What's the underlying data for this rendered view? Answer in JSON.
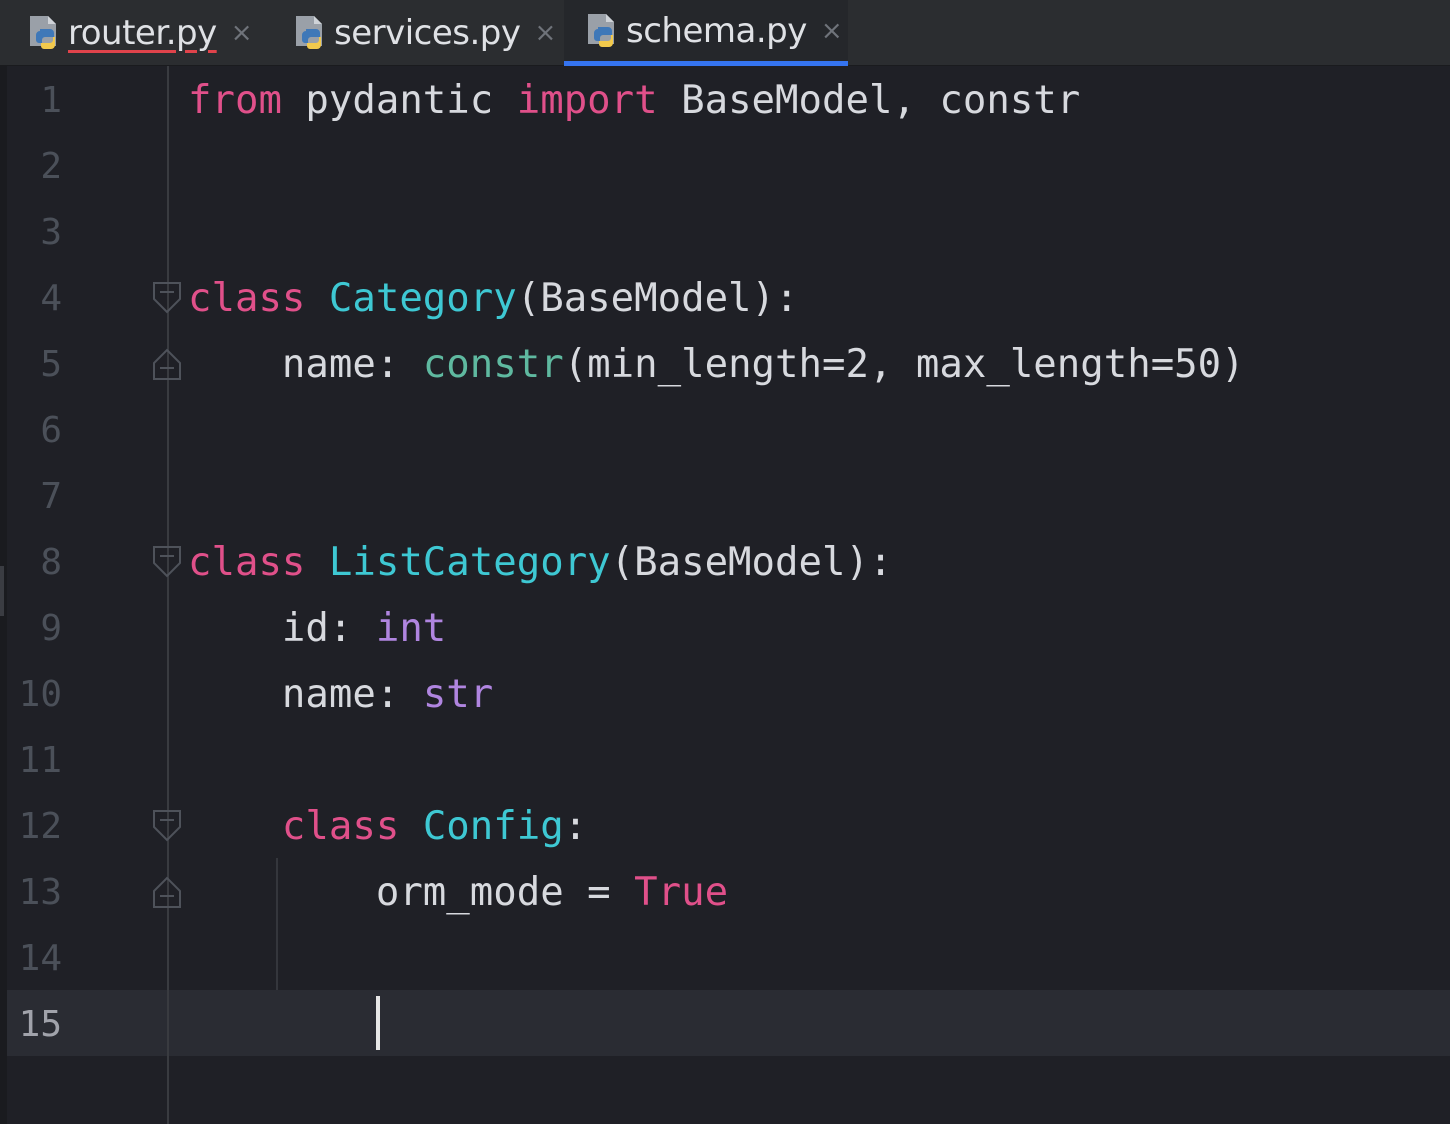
{
  "tabs": [
    {
      "label": "router.py",
      "close": "×",
      "icon": "python-file-icon",
      "has_error": true
    },
    {
      "label": "services.py",
      "close": "×",
      "icon": "python-file-icon"
    },
    {
      "label": "schema.py",
      "close": "×",
      "icon": "python-file-icon",
      "active": true
    }
  ],
  "editor": {
    "current_line": 15,
    "lines": [
      {
        "n": "1",
        "t": [
          [
            "kw",
            "from"
          ],
          [
            "tx",
            " pydantic "
          ],
          [
            "kw",
            "import"
          ],
          [
            "tx",
            " BaseModel, constr"
          ]
        ]
      },
      {
        "n": "2",
        "t": []
      },
      {
        "n": "3",
        "t": []
      },
      {
        "n": "4",
        "t": [
          [
            "kw",
            "class"
          ],
          [
            "tx",
            " "
          ],
          [
            "cls",
            "Category"
          ],
          [
            "tx",
            "(BaseModel):"
          ]
        ]
      },
      {
        "n": "5",
        "t": [
          [
            "tx",
            "    name: "
          ],
          [
            "fn",
            "constr"
          ],
          [
            "tx",
            "(min_length=2, max_length=50)"
          ]
        ]
      },
      {
        "n": "6",
        "t": []
      },
      {
        "n": "7",
        "t": []
      },
      {
        "n": "8",
        "t": [
          [
            "kw",
            "class"
          ],
          [
            "tx",
            " "
          ],
          [
            "cls",
            "ListCategory"
          ],
          [
            "tx",
            "(BaseModel):"
          ]
        ]
      },
      {
        "n": "9",
        "t": [
          [
            "tx",
            "    id: "
          ],
          [
            "bi",
            "int"
          ]
        ]
      },
      {
        "n": "10",
        "t": [
          [
            "tx",
            "    name: "
          ],
          [
            "bi",
            "str"
          ]
        ]
      },
      {
        "n": "11",
        "t": []
      },
      {
        "n": "12",
        "t": [
          [
            "tx",
            "    "
          ],
          [
            "kw",
            "class"
          ],
          [
            "tx",
            " "
          ],
          [
            "cls",
            "Config"
          ],
          [
            "tx",
            ":"
          ]
        ]
      },
      {
        "n": "13",
        "t": [
          [
            "tx",
            "        orm_mode = "
          ],
          [
            "kw",
            "True"
          ]
        ]
      },
      {
        "n": "14",
        "t": []
      },
      {
        "n": "15",
        "t": []
      }
    ],
    "fold_markers": [
      {
        "line": 4,
        "kind": "start"
      },
      {
        "line": 5,
        "kind": "end"
      },
      {
        "line": 8,
        "kind": "start"
      },
      {
        "line": 12,
        "kind": "start"
      },
      {
        "line": 13,
        "kind": "end"
      }
    ]
  },
  "colors": {
    "keyword": "#e0508a",
    "class_name": "#3ec8d3",
    "function": "#5fb9a0",
    "builtin": "#b085e0",
    "text": "#d7d9de",
    "background": "#1f2026",
    "tab_active_underline": "#3574f0"
  }
}
